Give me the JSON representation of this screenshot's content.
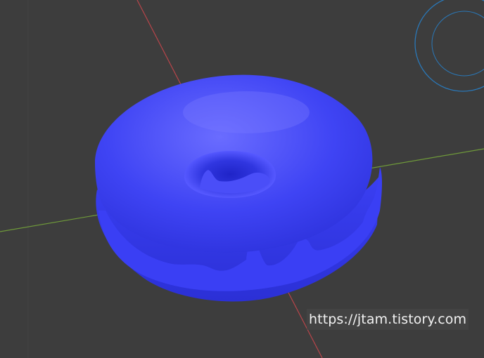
{
  "viewport": {
    "background": "#3d3d3d",
    "grid_color": "#474747",
    "axis_x_color": "#b8454a",
    "axis_y_color": "#6f9a3a",
    "gizmo_color": "#2a78b8",
    "object_color": "#3a3ff2"
  },
  "watermark": {
    "text": "https://jtam.tistory.com"
  }
}
